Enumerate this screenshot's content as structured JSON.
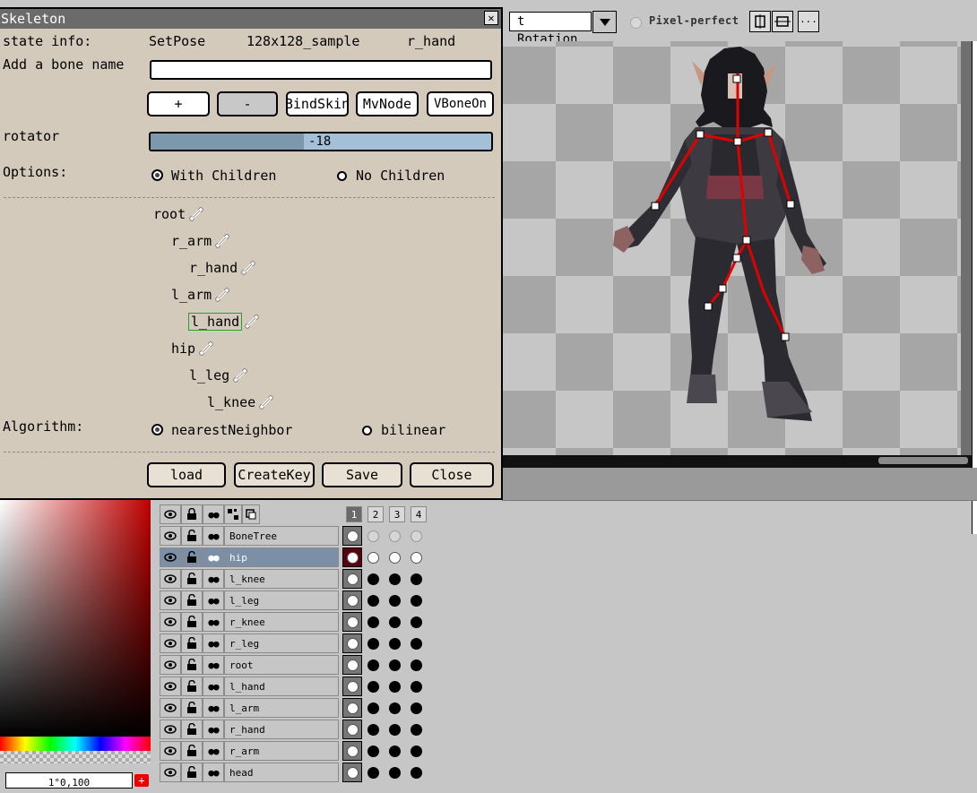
{
  "toolbar": {
    "rotation_value": "t Rotation",
    "pixel_perfect_label": "Pixel-perfect",
    "more_label": "···"
  },
  "dialog": {
    "title": "Skeleton",
    "close_glyph": "✕",
    "state_info_label": "state info:",
    "state": "SetPose",
    "sprite_name": "128x128_sample",
    "bone_selected": "r_hand",
    "add_bone_label": "Add a bone name",
    "add_bone_value": "",
    "buttons": {
      "add": "+",
      "remove": "-",
      "bind_skin": "BindSkin",
      "mv_node": "MvNode",
      "vbone_on": "VBoneOn"
    },
    "rotator_label": "rotator",
    "rotator_value": "-18",
    "rotator_fraction": 0.45,
    "options_label": "Options:",
    "option_with_children": "With Children",
    "option_no_children": "No Children",
    "option_selected": "With Children",
    "bone_tree": [
      {
        "name": "root",
        "depth": 0,
        "selected": false
      },
      {
        "name": "r_arm",
        "depth": 1,
        "selected": false
      },
      {
        "name": "r_hand",
        "depth": 2,
        "selected": false
      },
      {
        "name": "l_arm",
        "depth": 1,
        "selected": false
      },
      {
        "name": "l_hand",
        "depth": 2,
        "selected": true
      },
      {
        "name": "hip",
        "depth": 1,
        "selected": false
      },
      {
        "name": "l_leg",
        "depth": 2,
        "selected": false
      },
      {
        "name": "l_knee",
        "depth": 3,
        "selected": false
      }
    ],
    "algorithm_label": "Algorithm:",
    "algo_nearest": "nearestNeighbor",
    "algo_bilinear": "bilinear",
    "algo_selected": "nearestNeighbor",
    "footer": {
      "load": "load",
      "create_key": "CreateKey",
      "save": "Save",
      "close": "Close"
    }
  },
  "frames": [
    "1",
    "2",
    "3",
    "4"
  ],
  "active_frame": "1",
  "layers": [
    {
      "name": "BoneTree",
      "selected": false,
      "cels": [
        "w",
        "e",
        "e",
        "e"
      ]
    },
    {
      "name": "hip",
      "selected": true,
      "cels": [
        "w",
        "w",
        "w",
        "w"
      ]
    },
    {
      "name": "l_knee",
      "selected": false,
      "cels": [
        "w",
        "b",
        "b",
        "b"
      ]
    },
    {
      "name": "l_leg",
      "selected": false,
      "cels": [
        "w",
        "b",
        "b",
        "b"
      ]
    },
    {
      "name": "r_knee",
      "selected": false,
      "cels": [
        "w",
        "b",
        "b",
        "b"
      ]
    },
    {
      "name": "r_leg",
      "selected": false,
      "cels": [
        "w",
        "b",
        "b",
        "b"
      ]
    },
    {
      "name": "root",
      "selected": false,
      "cels": [
        "w",
        "b",
        "b",
        "b"
      ]
    },
    {
      "name": "l_hand",
      "selected": false,
      "cels": [
        "w",
        "b",
        "b",
        "b"
      ]
    },
    {
      "name": "l_arm",
      "selected": false,
      "cels": [
        "w",
        "b",
        "b",
        "b"
      ]
    },
    {
      "name": "r_hand",
      "selected": false,
      "cels": [
        "w",
        "b",
        "b",
        "b"
      ]
    },
    {
      "name": "r_arm",
      "selected": false,
      "cels": [
        "w",
        "b",
        "b",
        "b"
      ]
    },
    {
      "name": "head",
      "selected": false,
      "cels": [
        "w",
        "b",
        "b",
        "b"
      ]
    }
  ],
  "color_panel": {
    "value_text": "1°0,100",
    "hue_max": "0"
  },
  "colors": {
    "dialog_bg": "#d4cabc",
    "selection_outline": "#2aa02a",
    "bone_line": "#e00000",
    "selected_layer": "#7b8fa6"
  }
}
